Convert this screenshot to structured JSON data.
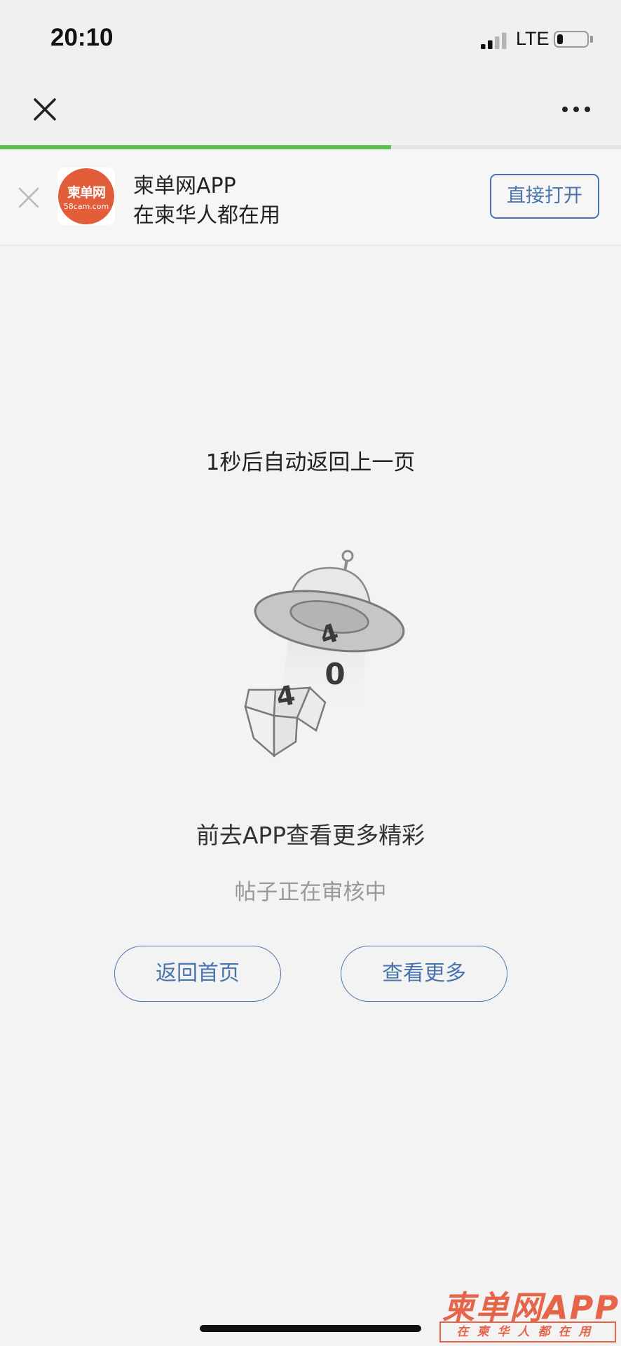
{
  "status_bar": {
    "time": "20:10",
    "network": "LTE",
    "signal_bars": 2,
    "signal_bars_total": 4,
    "battery_level": 0.2,
    "icons": [
      "signal-icon",
      "battery-icon"
    ]
  },
  "nav": {
    "close_icon": "close-icon",
    "more_icon": "more-dots-icon",
    "load_progress": 0.63,
    "progress_color": "#5ac34d"
  },
  "banner": {
    "logo_text": "柬单网",
    "logo_domain": "58cam.com",
    "title": "柬单网APP",
    "subtitle": "在柬华人都在用",
    "open_button": "直接打开",
    "close_icon": "close-icon"
  },
  "main": {
    "countdown": "1秒后自动返回上一页",
    "error_digits": [
      "4",
      "0",
      "4"
    ],
    "illustration": "ufo-404-icon",
    "promo": "前去APP查看更多精彩",
    "status": "帖子正在审核中",
    "home_button": "返回首页",
    "more_button": "查看更多"
  },
  "watermark": {
    "title": "柬单网APP",
    "subtitle": "在柬华人都在用"
  },
  "colors": {
    "accent": "#4a74ad",
    "brand": "#e25d3a",
    "background": "#f3f3f3"
  }
}
